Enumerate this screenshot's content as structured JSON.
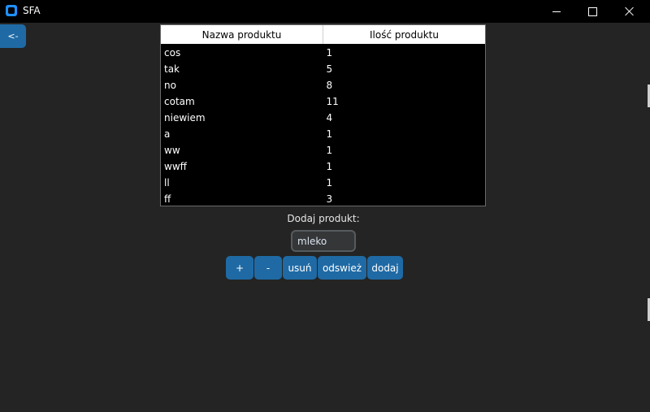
{
  "window": {
    "title": "SFA",
    "controls": [
      "minimize",
      "maximize",
      "close"
    ]
  },
  "back_button": {
    "label": "<-"
  },
  "table": {
    "columns": [
      "Nazwa produktu",
      "Ilość produktu"
    ],
    "rows": [
      [
        "cos",
        "1"
      ],
      [
        "tak",
        "5"
      ],
      [
        "no",
        "8"
      ],
      [
        "cotam",
        "11"
      ],
      [
        "niewiem",
        "4"
      ],
      [
        "a",
        "1"
      ],
      [
        "ww",
        "1"
      ],
      [
        "wwff",
        "1"
      ],
      [
        "ll",
        "1"
      ],
      [
        "ff",
        "3"
      ]
    ]
  },
  "form": {
    "label": "Dodaj produkt:",
    "input_value": "mleko"
  },
  "buttons": {
    "plus": "+",
    "minus": "-",
    "remove": "usuń",
    "refresh": "odswież",
    "add": "dodaj"
  },
  "colors": {
    "background": "#242424",
    "titlebar": "#000000",
    "accent": "#1f6aa5"
  }
}
